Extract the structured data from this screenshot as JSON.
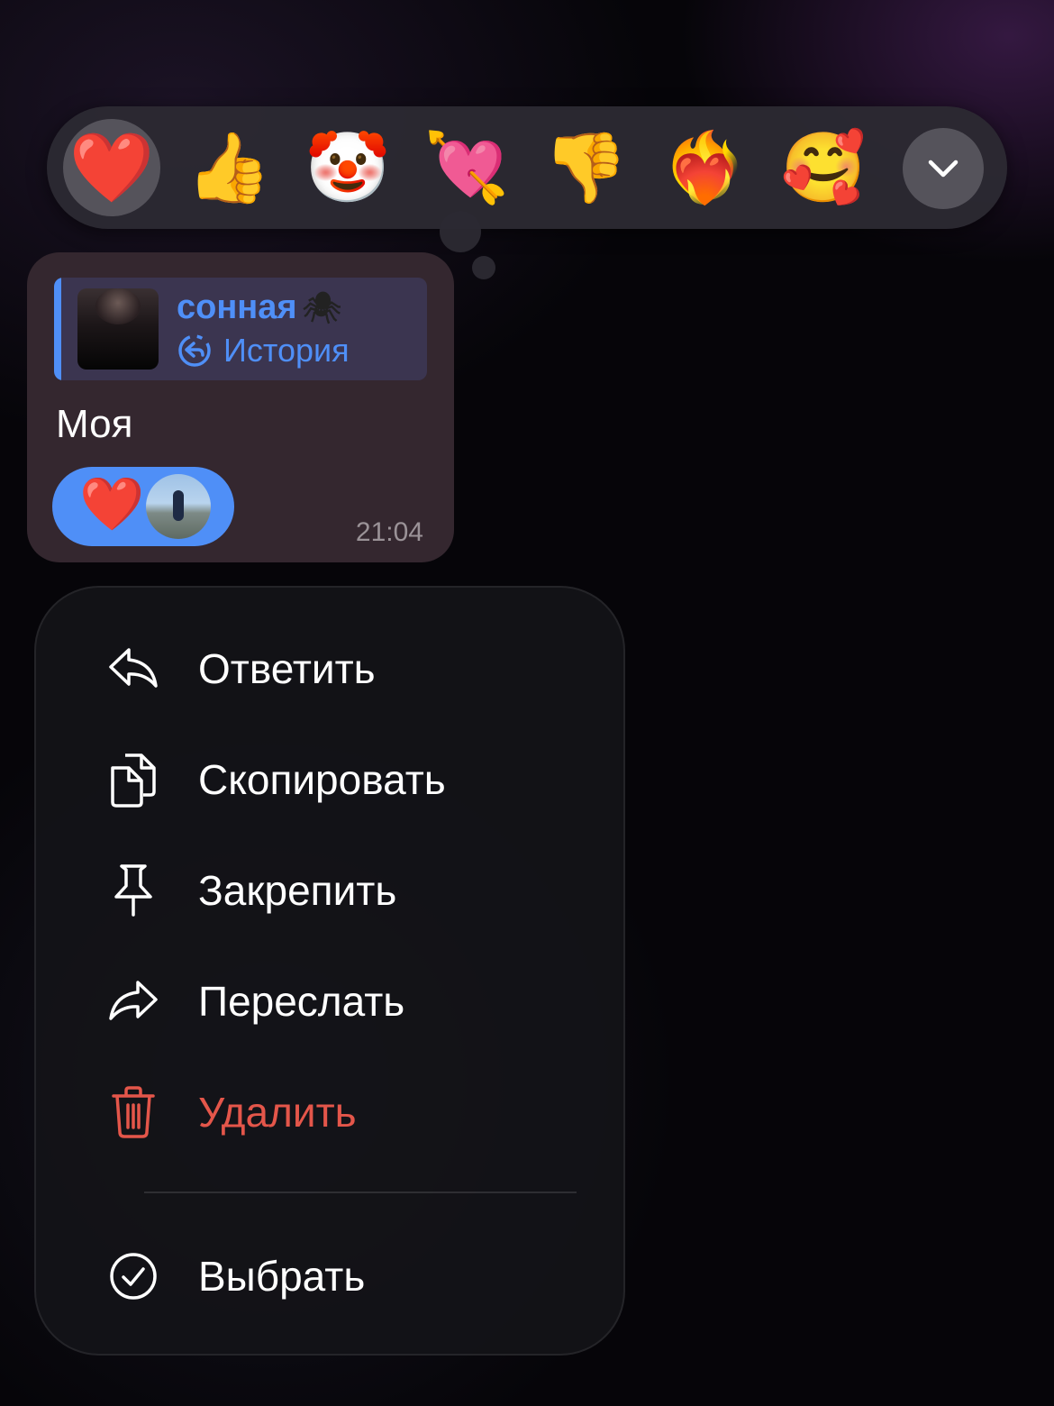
{
  "reactions": [
    {
      "emoji": "❤️",
      "name": "red-heart",
      "selected": true
    },
    {
      "emoji": "👍",
      "name": "thumbs-up",
      "selected": false
    },
    {
      "emoji": "🤡",
      "name": "clown-face",
      "selected": false
    },
    {
      "emoji": "💘",
      "name": "heart-with-arrow",
      "selected": false
    },
    {
      "emoji": "👎",
      "name": "thumbs-down",
      "selected": false
    },
    {
      "emoji": "❤️‍🔥",
      "name": "heart-on-fire",
      "selected": false
    },
    {
      "emoji": "🥰",
      "name": "smiling-face-with-hearts",
      "selected": false
    }
  ],
  "expand_icon": "chevron-down-icon",
  "message": {
    "reply_to": {
      "author": "сонная",
      "author_emoji": "🕷",
      "label": "История"
    },
    "text": "Моя",
    "reaction": {
      "emoji": "❤️"
    },
    "time": "21:04"
  },
  "menu": {
    "items": [
      {
        "label": "Ответить",
        "icon": "reply-icon"
      },
      {
        "label": "Скопировать",
        "icon": "copy-icon"
      },
      {
        "label": "Закрепить",
        "icon": "pin-icon"
      },
      {
        "label": "Переслать",
        "icon": "forward-icon"
      },
      {
        "label": "Удалить",
        "icon": "trash-icon",
        "destructive": true
      },
      {
        "label": "Выбрать",
        "icon": "select-check-icon"
      }
    ]
  },
  "colors": {
    "accent": "#4f8ff7",
    "danger": "#e4564a",
    "bubble": "#34272f"
  }
}
